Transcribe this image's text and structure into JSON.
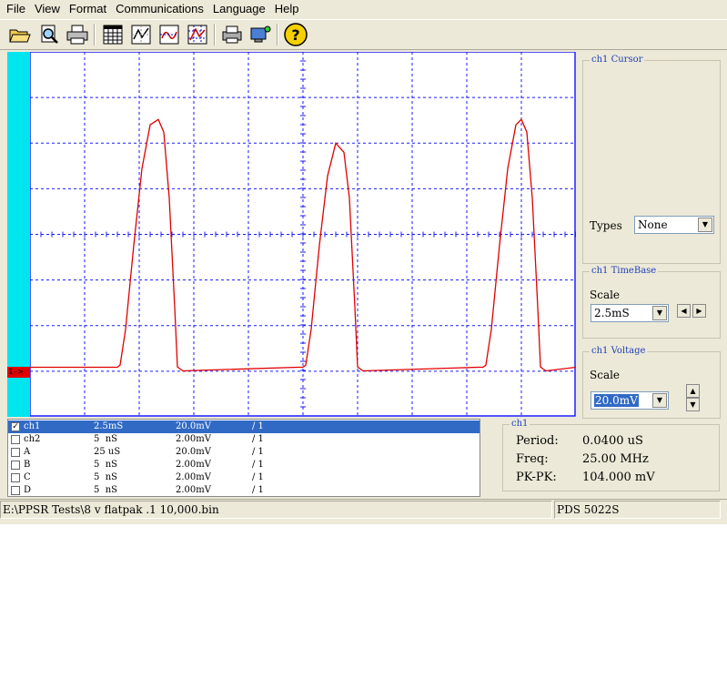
{
  "menu": [
    "File",
    "View",
    "Format",
    "Communications",
    "Language",
    "Help"
  ],
  "toolbar": {
    "icons": [
      "open-folder-icon",
      "print-preview-icon",
      "printer-icon",
      "grid-icon",
      "waveform-edit-icon",
      "measure-icon",
      "cursor-config-icon",
      "print-screen-icon",
      "connect-device-icon",
      "help-icon"
    ]
  },
  "colors": {
    "trace": "#e00000",
    "grid": "#1a1aff",
    "strip": "#00e5ee",
    "selection": "#316ac5"
  },
  "screen": {
    "channel_marker": "1->",
    "trace_points": [
      [
        0,
        0.136
      ],
      [
        0.16,
        0.136
      ],
      [
        0.165,
        0.142
      ],
      [
        0.175,
        0.24
      ],
      [
        0.19,
        0.47
      ],
      [
        0.205,
        0.68
      ],
      [
        0.22,
        0.8
      ],
      [
        0.235,
        0.815
      ],
      [
        0.245,
        0.78
      ],
      [
        0.255,
        0.6
      ],
      [
        0.265,
        0.3
      ],
      [
        0.27,
        0.137
      ],
      [
        0.28,
        0.126
      ],
      [
        0.49,
        0.136
      ],
      [
        0.5,
        0.136
      ],
      [
        0.505,
        0.142
      ],
      [
        0.515,
        0.24
      ],
      [
        0.53,
        0.47
      ],
      [
        0.545,
        0.66
      ],
      [
        0.56,
        0.75
      ],
      [
        0.575,
        0.725
      ],
      [
        0.585,
        0.6
      ],
      [
        0.595,
        0.3
      ],
      [
        0.6,
        0.137
      ],
      [
        0.61,
        0.126
      ],
      [
        0.82,
        0.136
      ],
      [
        0.83,
        0.136
      ],
      [
        0.835,
        0.142
      ],
      [
        0.845,
        0.24
      ],
      [
        0.86,
        0.47
      ],
      [
        0.875,
        0.68
      ],
      [
        0.89,
        0.8
      ],
      [
        0.9,
        0.815
      ],
      [
        0.91,
        0.78
      ],
      [
        0.92,
        0.6
      ],
      [
        0.93,
        0.3
      ],
      [
        0.935,
        0.137
      ],
      [
        0.945,
        0.126
      ],
      [
        1.0,
        0.136
      ]
    ]
  },
  "cursor_panel": {
    "title": "ch1 Cursor",
    "types_label": "Types",
    "types_value": "None"
  },
  "timebase_panel": {
    "title": "ch1 TimeBase",
    "scale_label": "Scale",
    "scale_value": "2.5mS"
  },
  "voltage_panel": {
    "title": "ch1 Voltage",
    "scale_label": "Scale",
    "scale_value": "20.0mV"
  },
  "channels": [
    {
      "name": "ch1",
      "time": "2.5mS",
      "volt": "20.0mV",
      "probe": "/ 1",
      "checked": true,
      "selected": true
    },
    {
      "name": "ch2",
      "time": "5  nS",
      "volt": "2.00mV",
      "probe": "/ 1",
      "checked": false,
      "selected": false
    },
    {
      "name": "A",
      "time": "25 uS",
      "volt": "20.0mV",
      "probe": "/ 1",
      "checked": false,
      "selected": false
    },
    {
      "name": "B",
      "time": "5  nS",
      "volt": "2.00mV",
      "probe": "/ 1",
      "checked": false,
      "selected": false
    },
    {
      "name": "C",
      "time": "5  nS",
      "volt": "2.00mV",
      "probe": "/ 1",
      "checked": false,
      "selected": false
    },
    {
      "name": "D",
      "time": "5  nS",
      "volt": "2.00mV",
      "probe": "/ 1",
      "checked": false,
      "selected": false
    }
  ],
  "measurements": {
    "title": "ch1",
    "period_label": "Period:",
    "period_value": "0.0400 uS",
    "freq_label": "Freq:",
    "freq_value": "25.00 MHz",
    "pkpk_label": "PK-PK:",
    "pkpk_value": "104.000 mV"
  },
  "status": {
    "file": "E:\\PPSR Tests\\8 v flatpak .1 10,000.bin",
    "device": "PDS 5022S"
  }
}
